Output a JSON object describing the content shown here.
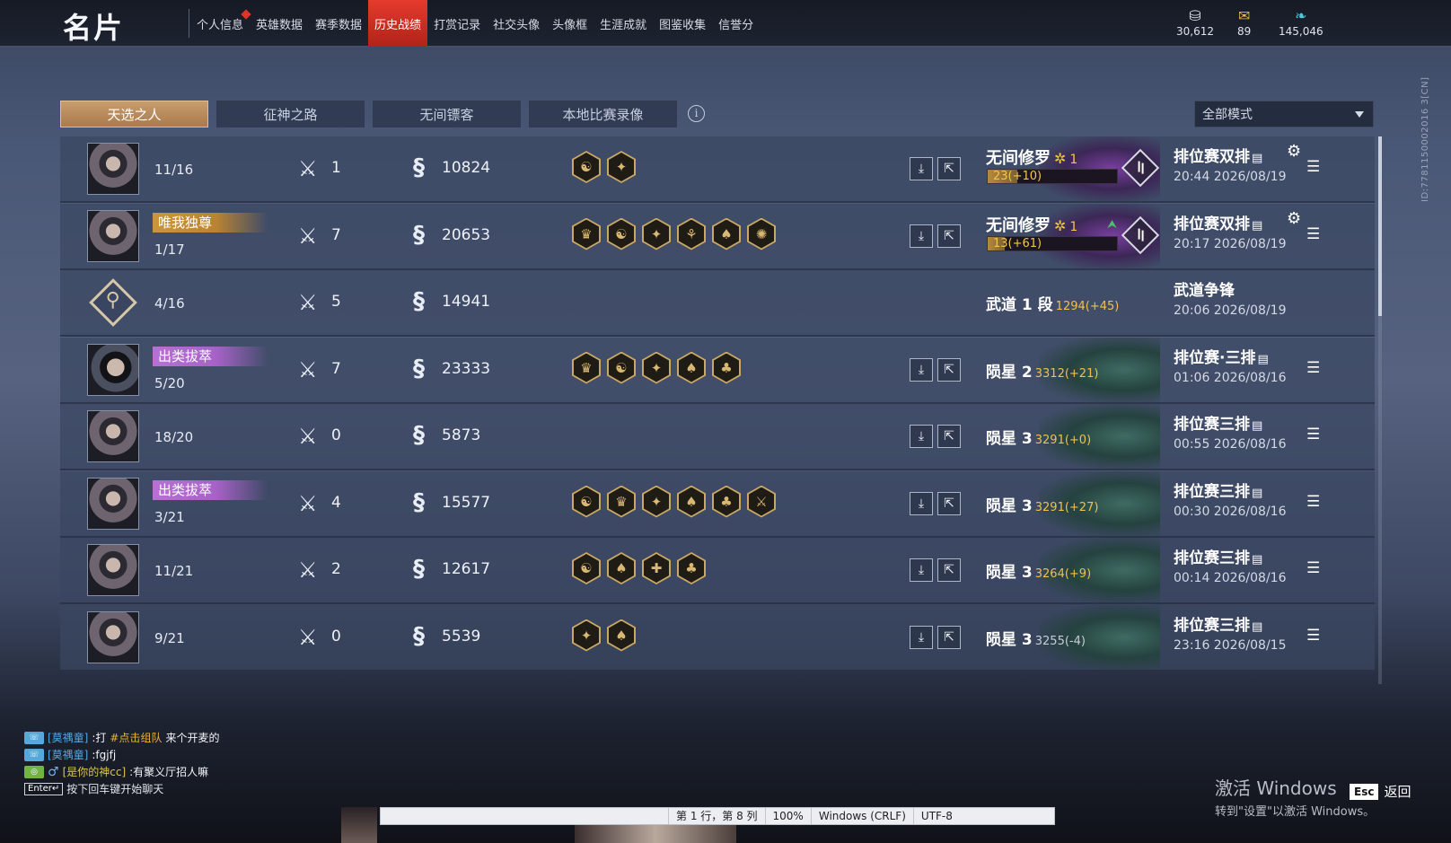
{
  "header": {
    "title": "名片",
    "nav": [
      {
        "label": "个人信息",
        "active": false,
        "dot": true
      },
      {
        "label": "英雄数据",
        "active": false
      },
      {
        "label": "赛季数据",
        "active": false
      },
      {
        "label": "历史战绩",
        "active": true
      },
      {
        "label": "打赏记录",
        "active": false
      },
      {
        "label": "社交头像",
        "active": false
      },
      {
        "label": "头像框",
        "active": false
      },
      {
        "label": "生涯成就",
        "active": false
      },
      {
        "label": "图鉴收集",
        "active": false
      },
      {
        "label": "信誉分",
        "active": false
      }
    ],
    "currencies": [
      {
        "icon": "coin-stack-icon",
        "value": "30,612"
      },
      {
        "icon": "ticket-icon",
        "value": "89"
      },
      {
        "icon": "feather-gem-icon",
        "value": "145,046"
      }
    ]
  },
  "side_id": "ID:7781150002016 3[CN]",
  "tabs": [
    {
      "label": "天选之人",
      "active": true
    },
    {
      "label": "征神之路",
      "active": false
    },
    {
      "label": "无间镖客",
      "active": false
    },
    {
      "label": "本地比赛录像",
      "active": false
    }
  ],
  "mode_select": {
    "value": "全部模式"
  },
  "rows": [
    {
      "avatar": "avatar-portrait",
      "title": "",
      "title_color": "",
      "rank": "11/16",
      "kills": "1",
      "damage": "10824",
      "medals": [
        "☯",
        "✦"
      ],
      "actions": true,
      "art": "purple",
      "mode": "无间修罗",
      "mode_star": true,
      "mode_lvl": "1",
      "bar_text": "23(+10)",
      "bar_fill": 0.23,
      "up": false,
      "match_type": "排位赛双排",
      "time": "20:44  2026/08/19",
      "gear": true
    },
    {
      "avatar": "avatar-portrait",
      "title": "唯我独尊",
      "title_color": "gold",
      "rank": "1/17",
      "kills": "7",
      "damage": "20653",
      "medals": [
        "♛",
        "☯",
        "✦",
        "⚘",
        "♠",
        "✺"
      ],
      "actions": true,
      "art": "purple",
      "mode": "无间修罗",
      "mode_star": true,
      "mode_lvl": "1",
      "bar_text": "13(+61)",
      "bar_fill": 0.13,
      "up": true,
      "match_type": "排位赛双排",
      "time": "20:17  2026/08/19",
      "gear": true
    },
    {
      "avatar": "sect",
      "title": "",
      "title_color": "",
      "rank": "4/16",
      "kills": "5",
      "damage": "14941",
      "medals": [],
      "actions": false,
      "art": "none",
      "rank_name": "武道 1 段",
      "pts": "1294(+45)",
      "match_type": "武道争锋",
      "time": "20:06  2026/08/19",
      "gear": false,
      "menu": false
    },
    {
      "avatar": "avatar-eyepatch",
      "title": "出类拔萃",
      "title_color": "purple",
      "rank": "5/20",
      "kills": "7",
      "damage": "23333",
      "medals": [
        "♛",
        "☯",
        "✦",
        "♠",
        "♣"
      ],
      "actions": true,
      "art": "green",
      "rank_name": "陨星 2",
      "pts": "3312(+21)",
      "match_type": "排位赛·三排",
      "time": "01:06  2026/08/16",
      "gear": false
    },
    {
      "avatar": "avatar-portrait",
      "title": "",
      "title_color": "",
      "rank": "18/20",
      "kills": "0",
      "damage": "5873",
      "medals": [],
      "actions": true,
      "art": "green",
      "rank_name": "陨星 3",
      "pts": "3291(+0)",
      "match_type": "排位赛三排",
      "time": "00:55  2026/08/16",
      "gear": false
    },
    {
      "avatar": "avatar-portrait",
      "title": "出类拔萃",
      "title_color": "purple",
      "rank": "3/21",
      "kills": "4",
      "damage": "15577",
      "medals": [
        "☯",
        "♛",
        "✦",
        "♠",
        "♣",
        "⚔"
      ],
      "actions": true,
      "art": "green",
      "rank_name": "陨星 3",
      "pts": "3291(+27)",
      "match_type": "排位赛三排",
      "time": "00:30  2026/08/16",
      "gear": false
    },
    {
      "avatar": "avatar-portrait",
      "title": "",
      "title_color": "",
      "rank": "11/21",
      "kills": "2",
      "damage": "12617",
      "medals": [
        "☯",
        "♠",
        "✚",
        "♣"
      ],
      "actions": true,
      "art": "green",
      "rank_name": "陨星 3",
      "pts": "3264(+9)",
      "match_type": "排位赛三排",
      "time": "00:14  2026/08/16",
      "gear": false
    },
    {
      "avatar": "avatar-portrait",
      "title": "",
      "title_color": "",
      "rank": "9/21",
      "kills": "0",
      "damage": "5539",
      "medals": [
        "✦",
        "♠"
      ],
      "actions": true,
      "art": "green",
      "rank_name": "陨星 3",
      "pts": "3255(-4)",
      "pts_neg": true,
      "match_type": "排位赛三排",
      "time": "23:16  2026/08/15",
      "gear": false
    }
  ],
  "chat": [
    {
      "channel": "team",
      "who": "[莫禑童]",
      "pre": ":打",
      "highlight": "#点击组队",
      "post": " 来个开麦的"
    },
    {
      "channel": "team",
      "who": "[莫禑童]",
      "pre": ":fgjfj",
      "highlight": "",
      "post": ""
    },
    {
      "channel": "world",
      "who": "[是你的神cc]",
      "pre": ":有聚义厅招人嘛",
      "highlight": "",
      "post": "",
      "gender": "♂"
    }
  ],
  "chat_hint": {
    "key": "Enter↵",
    "text": "按下回车键开始聊天"
  },
  "activate": {
    "line1": "激活 Windows",
    "line2": "转到\"设置\"以激活 Windows。"
  },
  "esc": {
    "key": "Esc",
    "label": "返回"
  },
  "statusbar": {
    "position": "第 1 行，第 8 列",
    "zoom": "100%",
    "eol": "Windows (CRLF)",
    "encoding": "UTF-8"
  }
}
